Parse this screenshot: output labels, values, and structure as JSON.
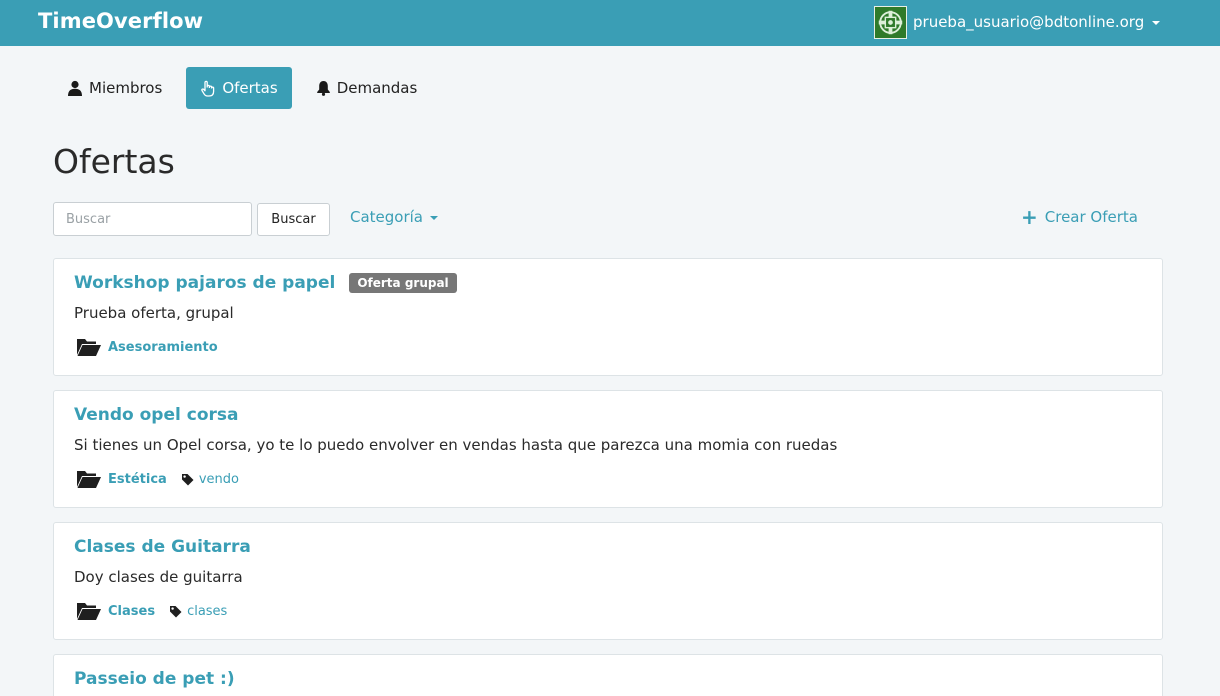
{
  "navbar": {
    "brand": "TimeOverflow",
    "user_email": "prueba_usuario@bdtonline.org",
    "avatar_icon": "organization-logo-icon",
    "brand_color": "#3a9eb5"
  },
  "tabs": [
    {
      "label": "Miembros",
      "icon": "user-icon",
      "active": false
    },
    {
      "label": "Ofertas",
      "icon": "hand-pointer-icon",
      "active": true
    },
    {
      "label": "Demandas",
      "icon": "bell-icon",
      "active": false
    }
  ],
  "page": {
    "title": "Ofertas"
  },
  "toolbar": {
    "search_placeholder": "Buscar",
    "search_button": "Buscar",
    "category_dropdown": "Categoría",
    "create_offer": "Crear Oferta"
  },
  "offers": [
    {
      "title": "Workshop pajaros de papel",
      "badge": "Oferta grupal",
      "description": "Prueba oferta, grupal",
      "category": "Asesoramiento",
      "tag": ""
    },
    {
      "title": "Vendo opel corsa",
      "badge": "",
      "description": "Si tienes un Opel corsa, yo te lo puedo envolver en vendas hasta que parezca una momia con ruedas",
      "category": "Estética",
      "tag": "vendo"
    },
    {
      "title": "Clases de Guitarra",
      "badge": "",
      "description": "Doy clases de guitarra",
      "category": "Clases",
      "tag": "clases"
    },
    {
      "title": "Passeio de pet :)",
      "badge": "",
      "description": "",
      "category": "",
      "tag": ""
    }
  ]
}
